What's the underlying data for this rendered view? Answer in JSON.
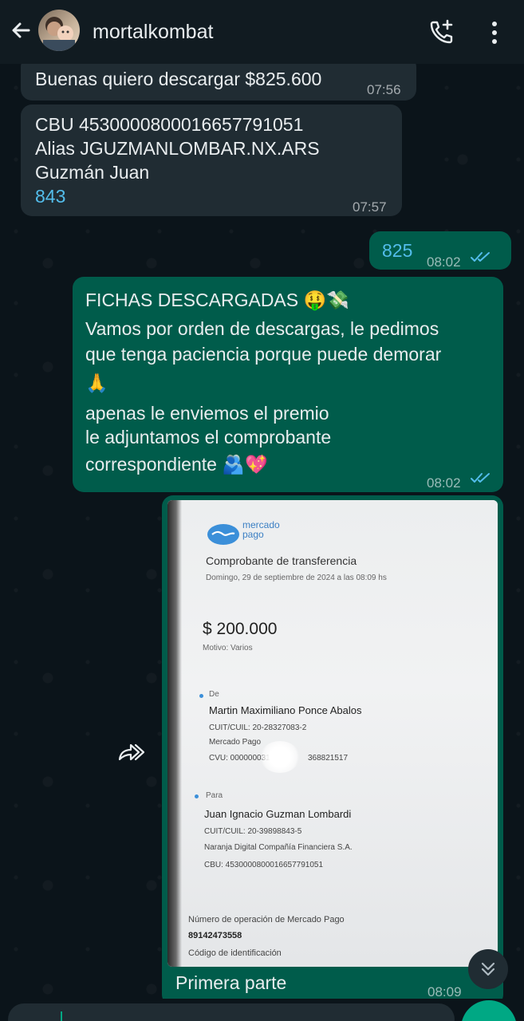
{
  "header": {
    "contact_name": "mortalkombat"
  },
  "messages": {
    "m1": {
      "text": "Buenas quiero descargar $825.600",
      "time": "07:56"
    },
    "m2": {
      "line1": "CBU 4530000800016657791051",
      "line2": "Alias JGUZMANLOMBAR.NX.ARS",
      "line3": "Guzmán Juan",
      "link": "843",
      "time": "07:57"
    },
    "m3": {
      "text": "825",
      "time": "08:02"
    },
    "m4": {
      "line1": "FICHAS DESCARGADAS 🤑💸",
      "line2": "Vamos por orden de descargas, le pedimos",
      "line3": "que tenga paciencia porque puede demorar",
      "line4": "🙏",
      "line5": "apenas le enviemos el premio",
      "line6": "le adjuntamos el comprobante",
      "line7": "correspondiente 🫂💖",
      "time": "08:02"
    },
    "m5": {
      "caption": "Primera parte",
      "time": "08:09"
    }
  },
  "receipt": {
    "brand_line1": "mercado",
    "brand_line2": "pago",
    "title": "Comprobante de transferencia",
    "date": "Domingo, 29 de septiembre de 2024 a las 08:09 hs",
    "amount": "$ 200.000",
    "motivo": "Motivo: Varios",
    "from_label": "De",
    "from_name": "Martin Maximiliano Ponce Abalos",
    "from_cuit": "CUIT/CUIL: 20-28327083-2",
    "from_bank": "Mercado Pago",
    "from_cvu_start": "CVU: 000000031",
    "from_cvu_end": "368821517",
    "to_label": "Para",
    "to_name": "Juan Ignacio Guzman Lombardi",
    "to_cuit": "CUIT/CUIL: 20-39898843-5",
    "to_bank": "Naranja Digital Compañía Financiera S.A.",
    "to_cbu": "CBU: 4530000800016657791051",
    "op_label": "Número de operación de Mercado Pago",
    "op_number": "89142473558",
    "id_label": "Código de identificación"
  },
  "colors": {
    "outgoing_bubble": "#005c4b",
    "incoming_bubble": "#202c33",
    "header_bg": "#111b21",
    "link": "#53bdeb",
    "read_ticks": "#53bdeb"
  },
  "icons": {
    "back": "arrow-left-icon",
    "call": "add-call-icon",
    "menu": "more-vertical-icon",
    "forward": "forward-icon",
    "scroll_down": "double-chevron-down-icon",
    "read_status": "double-check-icon"
  }
}
